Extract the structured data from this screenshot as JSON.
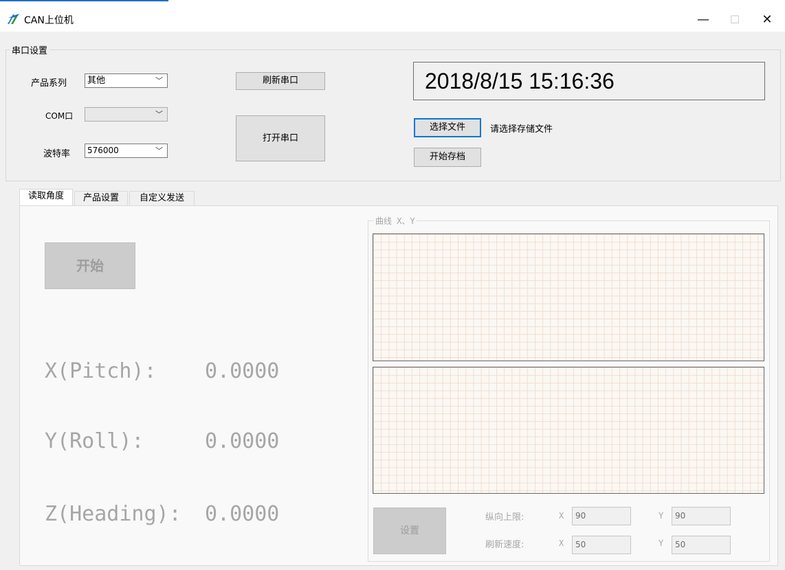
{
  "window": {
    "title": "CAN上位机",
    "controls": {
      "minimize": "—",
      "maximize": "☐",
      "close": "✕"
    }
  },
  "serial_group": {
    "title": "串口设置",
    "product_series": {
      "label": "产品系列",
      "value": "其他"
    },
    "com_port": {
      "label": "COM口",
      "value": ""
    },
    "baud_rate": {
      "label": "波特率",
      "value": "576000"
    },
    "refresh_button": "刷新串口",
    "open_button": "打开串口",
    "datetime": "2018/8/15 15:16:36",
    "select_file_button": "选择文件",
    "file_status": "请选择存储文件",
    "start_archive_button": "开始存档"
  },
  "tabs": [
    {
      "label": "读取角度",
      "active": true
    },
    {
      "label": "产品设置",
      "active": false
    },
    {
      "label": "自定义发送",
      "active": false
    }
  ],
  "angle_panel": {
    "start_button": "开始",
    "rows": [
      {
        "label": "X(Pitch):",
        "value": "0.0000"
      },
      {
        "label": "Y(Roll):",
        "value": "0.0000"
      },
      {
        "label": "Z(Heading):",
        "value": "0.0000"
      }
    ]
  },
  "curve_panel": {
    "title": "曲线 X、Y",
    "set_button": "设置",
    "upper_limit": {
      "label": "纵向上限:",
      "x_label": "X",
      "x_value": "90",
      "y_label": "Y",
      "y_value": "90"
    },
    "refresh_speed": {
      "label": "刷新速度:",
      "x_label": "X",
      "x_value": "50",
      "y_label": "Y",
      "y_value": "50"
    }
  },
  "colors": {
    "accent": "#0078d7",
    "disabled_text": "#a6a6a6",
    "grid_line": "#f2dccd"
  }
}
